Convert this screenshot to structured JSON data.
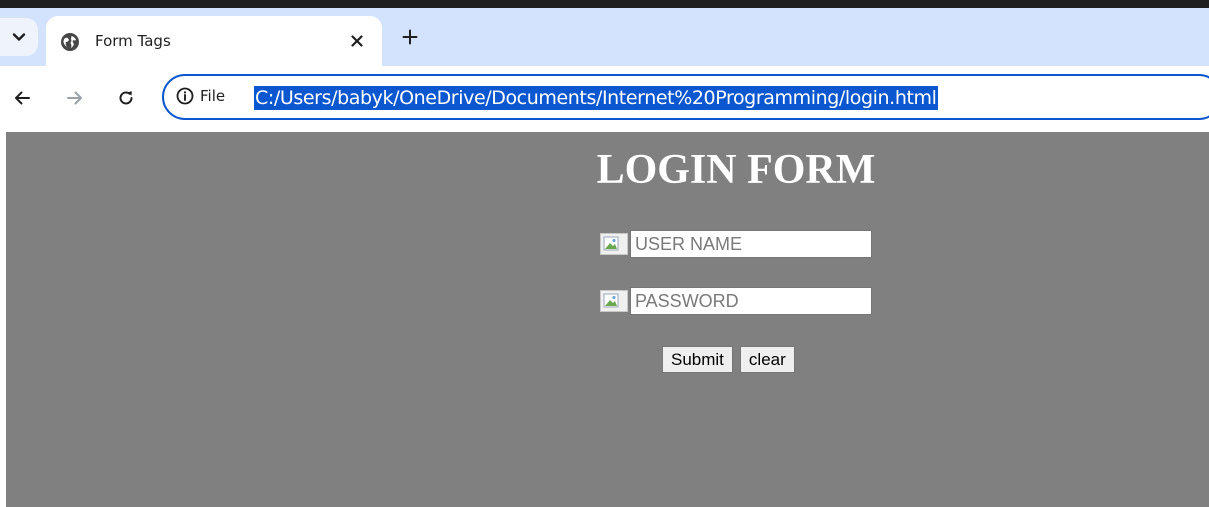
{
  "browser": {
    "tab_title": "Form Tags",
    "site_info_label": "File",
    "address": "C:/Users/babyk/OneDrive/Documents/Internet%20Programming/login.html",
    "accent_color": "#0b57d0"
  },
  "page": {
    "background_color": "#808080",
    "title": "LOGIN FORM",
    "username_placeholder": "USER NAME",
    "password_placeholder": "PASSWORD",
    "submit_label": "Submit",
    "clear_label": "clear"
  },
  "icons": {
    "tab_list": "chevron-down-icon",
    "favicon": "globe-icon",
    "close": "close-icon",
    "new_tab": "plus-icon",
    "back": "arrow-left-icon",
    "forward": "arrow-right-icon",
    "reload": "reload-icon",
    "site_info": "info-icon",
    "form_field_image": "broken-image-icon"
  }
}
